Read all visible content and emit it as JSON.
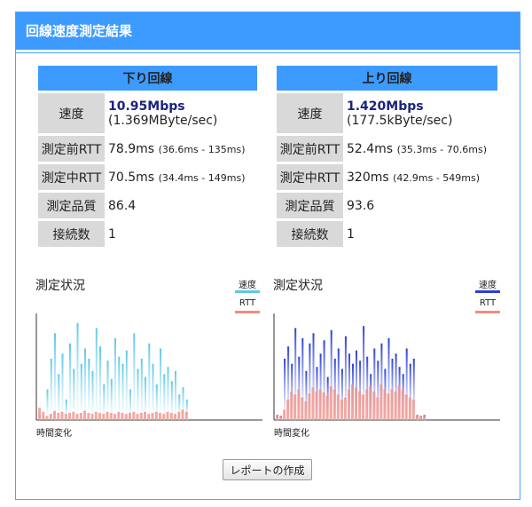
{
  "header": {
    "title": "回線速度測定結果"
  },
  "down": {
    "heading": "下り回線",
    "rows": {
      "speed_label": "速度",
      "speed_value": "10.95Mbps",
      "speed_sub": "(1.369MByte/sec)",
      "rtt_before_label": "測定前RTT",
      "rtt_before_value": "78.9ms",
      "rtt_before_range": "(36.6ms - 135ms)",
      "rtt_during_label": "測定中RTT",
      "rtt_during_value": "70.5ms",
      "rtt_during_range": "(34.4ms - 149ms)",
      "quality_label": "測定品質",
      "quality_value": "86.4",
      "conn_label": "接続数",
      "conn_value": "1"
    },
    "chart": {
      "title": "測定状況",
      "legend_speed": "速度",
      "legend_rtt": "RTT",
      "xlabel": "時間変化",
      "speed_color": "#5bc8e8",
      "rtt_color": "#f08c84"
    }
  },
  "up": {
    "heading": "上り回線",
    "rows": {
      "speed_label": "速度",
      "speed_value": "1.420Mbps",
      "speed_sub": "(177.5kByte/sec)",
      "rtt_before_label": "測定前RTT",
      "rtt_before_value": "52.4ms",
      "rtt_before_range": "(35.3ms - 70.6ms)",
      "rtt_during_label": "測定中RTT",
      "rtt_during_value": "320ms",
      "rtt_during_range": "(42.9ms - 549ms)",
      "quality_label": "測定品質",
      "quality_value": "93.6",
      "conn_label": "接続数",
      "conn_value": "1"
    },
    "chart": {
      "title": "測定状況",
      "legend_speed": "速度",
      "legend_rtt": "RTT",
      "xlabel": "時間変化",
      "speed_color": "#2b3fd6",
      "rtt_color": "#f08c84"
    }
  },
  "chart_data": [
    {
      "type": "bar",
      "title": "測定状況",
      "xlabel": "時間変化",
      "ylabel": "",
      "series": [
        {
          "name": "速度",
          "values": [
            0.05,
            0.02,
            0.3,
            0.6,
            0.85,
            0.45,
            0.65,
            0.2,
            0.75,
            0.5,
            0.95,
            0.55,
            0.7,
            0.6,
            0.48,
            0.9,
            0.72,
            0.35,
            0.58,
            0.4,
            0.8,
            0.62,
            0.55,
            0.68,
            0.3,
            0.85,
            0.5,
            0.6,
            0.42,
            0.75,
            0.55,
            0.35,
            0.7,
            0.45,
            0.52,
            0.38,
            0.48,
            0.25,
            0.32,
            0.2
          ]
        },
        {
          "name": "RTT",
          "values": [
            0.12,
            0.08,
            0.04,
            0.06,
            0.09,
            0.07,
            0.08,
            0.06,
            0.07,
            0.08,
            0.06,
            0.07,
            0.09,
            0.07,
            0.06,
            0.08,
            0.07,
            0.06,
            0.08,
            0.07,
            0.06,
            0.08,
            0.07,
            0.06,
            0.07,
            0.08,
            0.06,
            0.07,
            0.08,
            0.06,
            0.07,
            0.08,
            0.07,
            0.06,
            0.08,
            0.07,
            0.06,
            0.08,
            0.1,
            0.08
          ]
        }
      ]
    },
    {
      "type": "bar",
      "title": "測定状況",
      "xlabel": "時間変化",
      "ylabel": "",
      "series": [
        {
          "name": "速度",
          "values": [
            0.05,
            0.04,
            0.6,
            0.72,
            0.55,
            0.9,
            0.62,
            0.8,
            0.48,
            0.75,
            0.85,
            0.52,
            0.65,
            0.78,
            0.42,
            0.88,
            0.6,
            0.7,
            0.5,
            0.82,
            0.65,
            0.55,
            0.68,
            0.58,
            0.92,
            0.62,
            0.45,
            0.7,
            0.58,
            0.75,
            0.5,
            0.8,
            0.6,
            0.65,
            0.52,
            0.45,
            0.7,
            0.55,
            0.6,
            0.05,
            0.04,
            0.05
          ]
        },
        {
          "name": "RTT",
          "values": [
            0.05,
            0.04,
            0.1,
            0.2,
            0.28,
            0.25,
            0.3,
            0.22,
            0.18,
            0.26,
            0.32,
            0.28,
            0.3,
            0.27,
            0.24,
            0.33,
            0.3,
            0.25,
            0.2,
            0.22,
            0.3,
            0.35,
            0.32,
            0.28,
            0.25,
            0.3,
            0.33,
            0.28,
            0.22,
            0.35,
            0.3,
            0.26,
            0.3,
            0.28,
            0.34,
            0.3,
            0.25,
            0.22,
            0.2,
            0.05,
            0.04,
            0.05
          ]
        }
      ]
    }
  ]
}
